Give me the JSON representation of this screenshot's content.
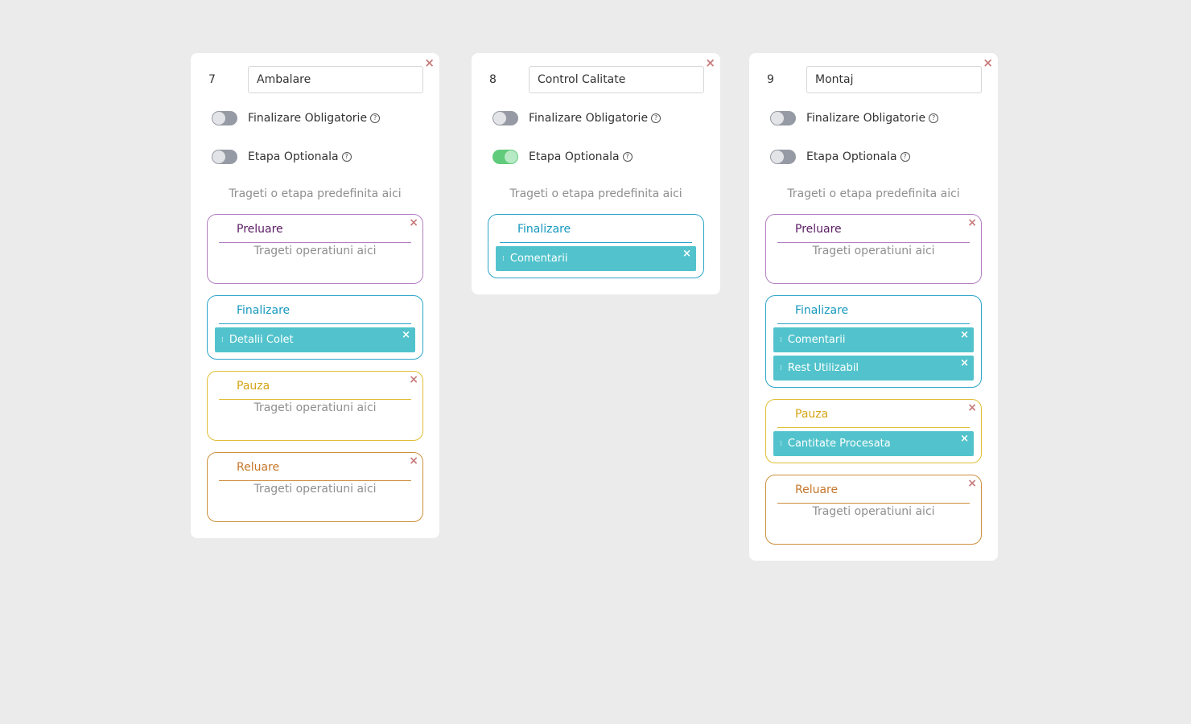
{
  "close_glyph": "×",
  "help_glyph": "?",
  "drag_glyph": "⁞",
  "cards": [
    {
      "number": "7",
      "name": "Ambalare",
      "finalizare_obligatorie": {
        "label": "Finalizare Obligatorie",
        "on": false
      },
      "etapa_optionala": {
        "label": "Etapa Optionala",
        "on": false
      },
      "drop_hint": "Trageti o etapa predefinita aici",
      "stages": [
        {
          "title": "Preluare",
          "type": "preluare",
          "closable": true,
          "empty_hint": "Trageti operatiuni aici",
          "operations": []
        },
        {
          "title": "Finalizare",
          "type": "finalizare",
          "closable": false,
          "operations": [
            "Detalii Colet"
          ]
        },
        {
          "title": "Pauza",
          "type": "pauza",
          "closable": true,
          "empty_hint": "Trageti operatiuni aici",
          "operations": []
        },
        {
          "title": "Reluare",
          "type": "reluare",
          "closable": true,
          "empty_hint": "Trageti operatiuni aici",
          "operations": []
        }
      ]
    },
    {
      "number": "8",
      "name": "Control Calitate",
      "finalizare_obligatorie": {
        "label": "Finalizare Obligatorie",
        "on": false
      },
      "etapa_optionala": {
        "label": "Etapa Optionala",
        "on": true
      },
      "drop_hint": "Trageti o etapa predefinita aici",
      "stages": [
        {
          "title": "Finalizare",
          "type": "finalizare",
          "closable": false,
          "operations": [
            "Comentarii"
          ]
        }
      ]
    },
    {
      "number": "9",
      "name": "Montaj",
      "finalizare_obligatorie": {
        "label": "Finalizare Obligatorie",
        "on": false
      },
      "etapa_optionala": {
        "label": "Etapa Optionala",
        "on": false
      },
      "drop_hint": "Trageti o etapa predefinita aici",
      "stages": [
        {
          "title": "Preluare",
          "type": "preluare",
          "closable": true,
          "empty_hint": "Trageti operatiuni aici",
          "operations": []
        },
        {
          "title": "Finalizare",
          "type": "finalizare",
          "closable": false,
          "operations": [
            "Comentarii",
            "Rest Utilizabil"
          ]
        },
        {
          "title": "Pauza",
          "type": "pauza",
          "closable": true,
          "operations": [
            "Cantitate Procesata"
          ]
        },
        {
          "title": "Reluare",
          "type": "reluare",
          "closable": true,
          "empty_hint": "Trageti operatiuni aici",
          "operations": []
        }
      ]
    }
  ]
}
